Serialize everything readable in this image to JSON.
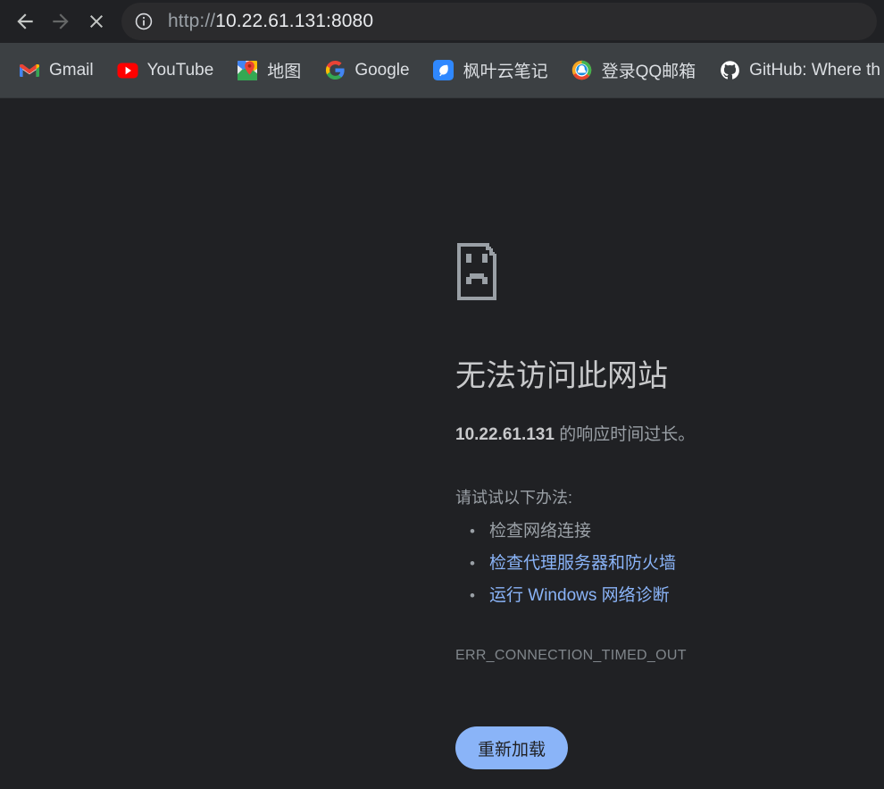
{
  "browser": {
    "nav": {
      "back_label": "Back",
      "forward_label": "Forward",
      "stop_label": "Stop"
    },
    "omnibox": {
      "scheme": "http://",
      "host": "10.22.61.131:8080",
      "full_url": "http://10.22.61.131:8080",
      "site_info_icon": "info-circle-icon"
    },
    "bookmarks": [
      {
        "label": "Gmail",
        "icon": "gmail-icon"
      },
      {
        "label": "YouTube",
        "icon": "youtube-icon"
      },
      {
        "label": "地图",
        "icon": "google-maps-icon"
      },
      {
        "label": "Google",
        "icon": "google-icon"
      },
      {
        "label": "枫叶云笔记",
        "icon": "maple-notes-icon"
      },
      {
        "label": "登录QQ邮箱",
        "icon": "qq-mail-icon"
      },
      {
        "label": "GitHub: Where th",
        "icon": "github-icon"
      }
    ]
  },
  "error_page": {
    "icon": "sad-document-icon",
    "title": "无法访问此网站",
    "summary_host": "10.22.61.131",
    "summary_rest": " 的响应时间过长。",
    "suggestions_title": "请试试以下办法:",
    "suggestions": [
      {
        "text": "检查网络连接",
        "is_link": false
      },
      {
        "text": "检查代理服务器和防火墙",
        "is_link": true
      },
      {
        "text": "运行 Windows 网络诊断",
        "is_link": true
      }
    ],
    "error_code": "ERR_CONNECTION_TIMED_OUT",
    "reload_label": "重新加载"
  },
  "colors": {
    "toolbar_bg": "#202124",
    "bookmarks_bg": "#3c4043",
    "page_bg": "#202124",
    "link_blue": "#8ab4f8",
    "text_gray": "#9aa0a6",
    "heading_gray": "#c8c9cb",
    "button_bg": "#8ab4f8"
  }
}
